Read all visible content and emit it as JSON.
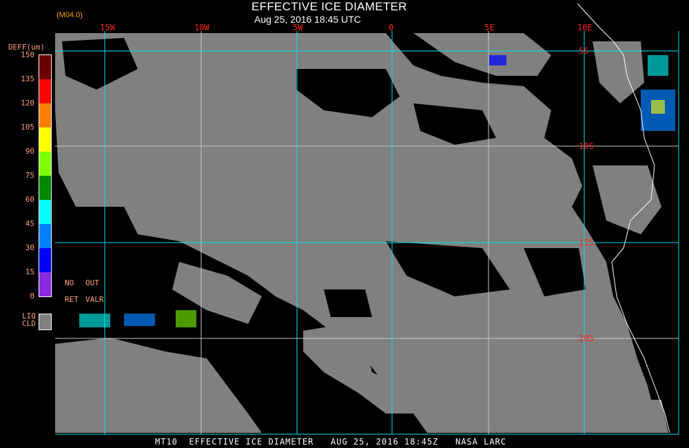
{
  "header": {
    "title": "EFFECTIVE ICE DIAMETER",
    "subtitle": "Aug 25, 2016 18:45 UTC",
    "organization": "NASA Langley (M04.0)"
  },
  "map": {
    "longitude_labels": [
      "15W",
      "10W",
      "5W",
      "0",
      "5E",
      "10E"
    ],
    "latitude_labels": [
      "5S",
      "10S",
      "15S",
      "20S"
    ],
    "colors": {
      "cloud_liquid": "#808080",
      "background": "#000000",
      "grid_cyan": "#00e5ee",
      "grid_white": "#c8c8c8",
      "coastline": "#ffffff"
    }
  },
  "legend": {
    "title": "DEFF(um)",
    "ticks": [
      "150",
      "135",
      "120",
      "105",
      "90",
      "75",
      "60",
      "45",
      "30",
      "15",
      "0"
    ],
    "colors": [
      "#6b0000",
      "#ff0000",
      "#ff8000",
      "#ffff00",
      "#80ff00",
      "#008800",
      "#00ffff",
      "#0080ff",
      "#0000ff",
      "#8a2be2"
    ],
    "no_ret_label_1": "NO",
    "no_ret_label_2": "RET",
    "out_valr_label_1": "OUT",
    "out_valr_label_2": "VALR",
    "liq_label_1": "LIQ",
    "liq_label_2": "CLD"
  },
  "footer": {
    "product": "MT10",
    "name": "EFFECTIVE ICE DIAMETER",
    "date": "AUG 25, 2016 18:45Z",
    "source": "NASA LARC"
  }
}
